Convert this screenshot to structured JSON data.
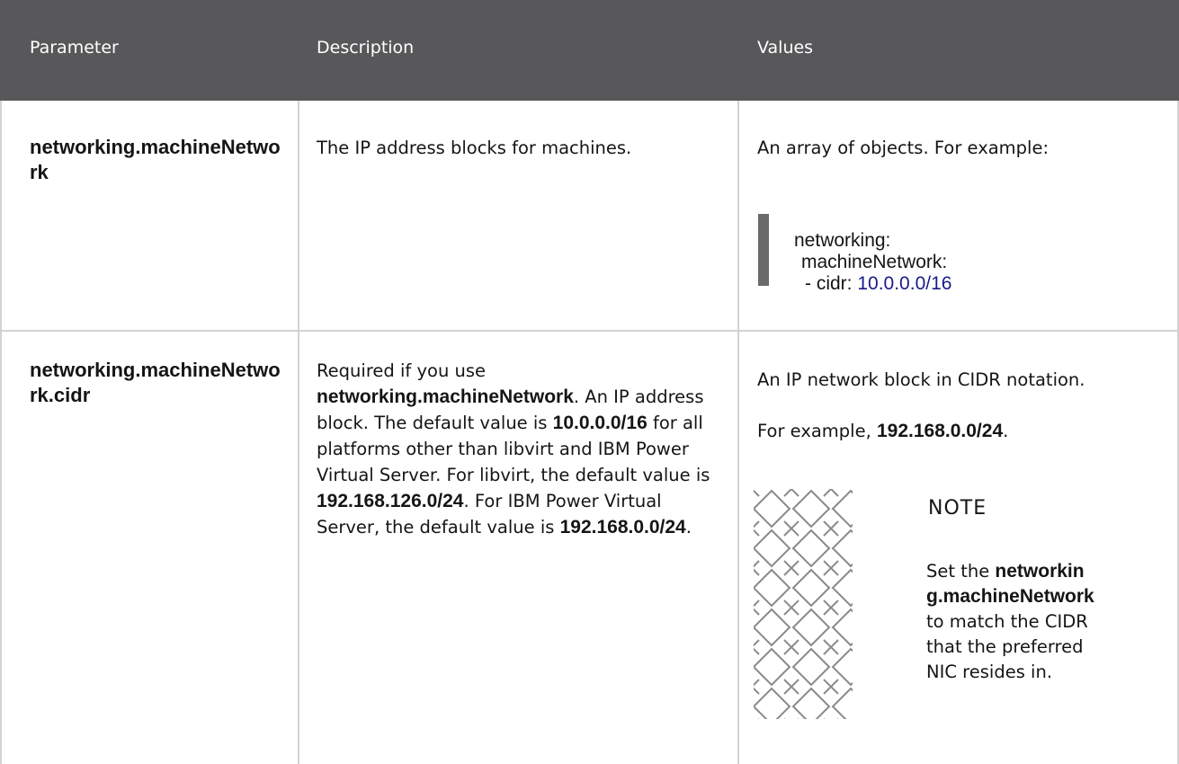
{
  "header": {
    "col_parameter": "Parameter",
    "col_description": "Description",
    "col_values": "Values"
  },
  "rows": [
    {
      "parameter": "networking.machineNetwork",
      "description": "The IP address blocks for machines.",
      "values_text": "An array of objects. For example:",
      "code": {
        "line1": "networking:",
        "line2": "machineNetwork:",
        "line3_prefix": "- cidr: ",
        "line3_value": "10.0.0.0/16"
      }
    },
    {
      "parameter": "networking.machineNetwork.cidr",
      "description": {
        "t1": "Required if you use ",
        "b1": "networking.machineNetwork",
        "t2": ". An IP address block. The default value is ",
        "b2": "10.0.0.0/16",
        "t3": " for all platforms other than libvirt and IBM Power Virtual Server. For libvirt, the default value is ",
        "b3": "192.168.126.0/24",
        "t4": ". For IBM Power Virtual Server, the default value is ",
        "b4": "192.168.0.0/24",
        "t5": "."
      },
      "values_text": "An IP network block in CIDR notation.",
      "example_prefix": "For example, ",
      "example_value": "192.168.0.0/24",
      "example_suffix": ".",
      "note": {
        "title": "NOTE",
        "t1": "Set the ",
        "b1": "networking.machineNetwork",
        "t2": " to match the CIDR that the preferred NIC resides in.",
        "icon": "note-pattern-icon"
      }
    }
  ],
  "colors": {
    "header_bg": "#58585a",
    "header_text": "#ffffff",
    "grid": "#d2d2d2",
    "code_bar": "#6a6a6a",
    "code_number": "#1a1a8c"
  }
}
